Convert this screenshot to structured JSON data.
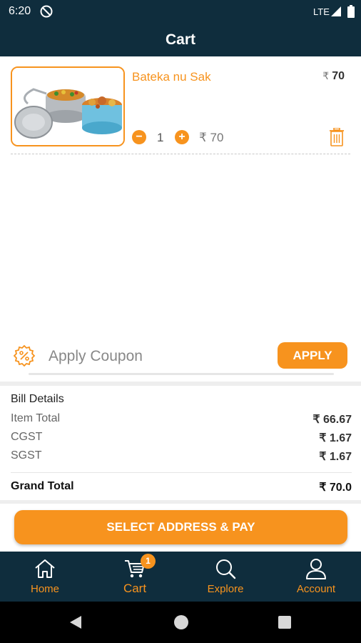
{
  "status_bar": {
    "time": "6:20",
    "network": "LTE"
  },
  "app_bar": {
    "title": "Cart"
  },
  "cart_items": [
    {
      "name": "Bateka nu Sak",
      "currency": "₹",
      "price": "70",
      "quantity": "1",
      "subtotal": "₹ 70",
      "image_icon": "tiffin-box-image"
    }
  ],
  "coupon": {
    "placeholder": "Apply Coupon",
    "apply_label": "APPLY",
    "icon": "discount-badge-icon"
  },
  "bill": {
    "title": "Bill Details",
    "rows": [
      {
        "label": "Item Total",
        "value": "₹ 66.67"
      },
      {
        "label": "CGST",
        "value": "₹ 1.67"
      },
      {
        "label": "SGST",
        "value": "₹ 1.67"
      }
    ],
    "grand_total_label": "Grand Total",
    "grand_total_value": "₹ 70.0"
  },
  "pay_button": {
    "label": "SELECT ADDRESS & PAY"
  },
  "bottom_nav": {
    "items": [
      {
        "label": "Home",
        "icon": "home-icon"
      },
      {
        "label": "Cart",
        "icon": "cart-icon",
        "badge": "1",
        "active": true
      },
      {
        "label": "Explore",
        "icon": "search-icon"
      },
      {
        "label": "Account",
        "icon": "user-icon"
      }
    ]
  },
  "colors": {
    "primary": "#0f2d3d",
    "accent": "#f7931e"
  }
}
